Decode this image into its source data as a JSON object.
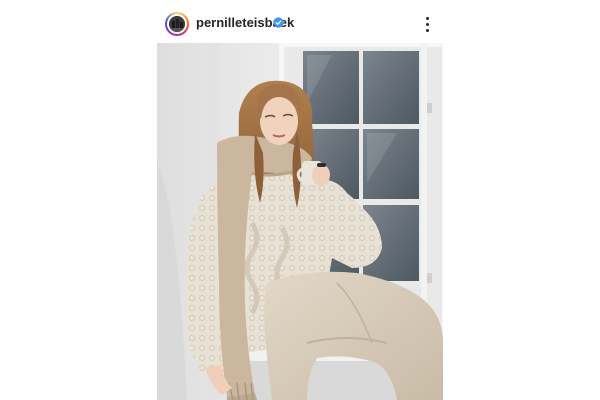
{
  "post": {
    "username": "pernilleteisbaek",
    "verified": true,
    "avatar_icon": "profile-avatar-icon",
    "verified_icon": "verified-badge-icon",
    "more_icon": "more-options-icon"
  },
  "colors": {
    "text": "#262626",
    "verified_blue": "#3897f0",
    "wall": "#ececec",
    "window_frame": "#f5f5f5",
    "glass": "#5d6770",
    "sweater": "#e6dfd3",
    "scarf": "#cbb79d",
    "hair": "#9a6a3e",
    "trousers": "#d8cdbd"
  }
}
